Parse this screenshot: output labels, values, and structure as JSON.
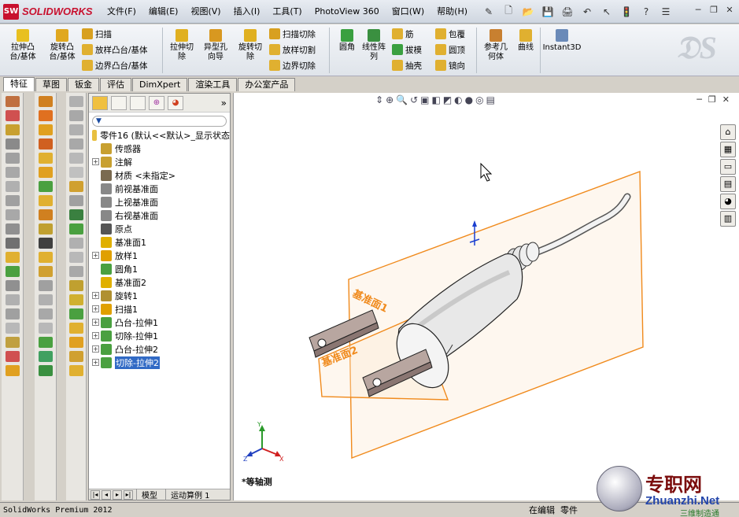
{
  "app": {
    "brand": "SOLIDWORKS"
  },
  "menu": [
    "文件(F)",
    "编辑(E)",
    "视图(V)",
    "插入(I)",
    "工具(T)",
    "PhotoView 360",
    "窗口(W)",
    "帮助(H)"
  ],
  "quick_icons": [
    "pin-icon",
    "new-icon",
    "open-icon",
    "save-icon",
    "print-icon",
    "undo-icon",
    "select-icon",
    "rebuild-icon",
    "help-icon",
    "options-icon"
  ],
  "commands": {
    "extrude_boss": "拉伸凸\n台/基体",
    "revolve_boss": "旋转凸\n台/基体",
    "sweep": "扫描",
    "loft_boss": "放样凸台/基体",
    "boundary_boss": "边界凸台/基体",
    "extrude_cut": "拉伸切\n除",
    "hole_wizard": "异型孔\n向导",
    "revolve_cut": "旋转切\n除",
    "swept_cut": "扫描切除",
    "lofted_cut": "放样切割",
    "boundary_cut": "边界切除",
    "fillet": "圆角",
    "linear_pattern": "线性阵\n列",
    "rib": "筋",
    "draft": "拔模",
    "shell": "抽壳",
    "wrap": "包覆",
    "dome": "圆顶",
    "mirror": "镜向",
    "ref_geometry": "参考几\n何体",
    "curves": "曲线",
    "instant3d": "Instant3D"
  },
  "tabs": [
    "特征",
    "草图",
    "钣金",
    "评估",
    "DimXpert",
    "渲染工具",
    "办公室产品"
  ],
  "active_tab": "特征",
  "tree": {
    "root": "零件16  (默认<<默认>_显示状态",
    "items": [
      {
        "label": "传感器",
        "expand": false,
        "color": "#c8a030"
      },
      {
        "label": "注解",
        "expand": true,
        "color": "#c8a030"
      },
      {
        "label": "材质 <未指定>",
        "expand": false,
        "color": "#7a6a50"
      },
      {
        "label": "前视基准面",
        "expand": false,
        "color": "#888888"
      },
      {
        "label": "上视基准面",
        "expand": false,
        "color": "#888888"
      },
      {
        "label": "右视基准面",
        "expand": false,
        "color": "#888888"
      },
      {
        "label": "原点",
        "expand": false,
        "color": "#555555"
      },
      {
        "label": "基准面1",
        "expand": false,
        "color": "#e0b000"
      },
      {
        "label": "放样1",
        "expand": true,
        "color": "#e0a000"
      },
      {
        "label": "圆角1",
        "expand": false,
        "color": "#4aa040"
      },
      {
        "label": "基准面2",
        "expand": false,
        "color": "#e0b000"
      },
      {
        "label": "旋转1",
        "expand": true,
        "color": "#b09030"
      },
      {
        "label": "扫描1",
        "expand": true,
        "color": "#e0a000"
      },
      {
        "label": "凸台-拉伸1",
        "expand": true,
        "color": "#4aa040"
      },
      {
        "label": "切除-拉伸1",
        "expand": true,
        "color": "#4aa040"
      },
      {
        "label": "凸台-拉伸2",
        "expand": true,
        "color": "#4aa040"
      },
      {
        "label": "切除-拉伸2",
        "expand": true,
        "color": "#4aa040",
        "selected": true
      }
    ]
  },
  "fm_bottom_tabs": [
    "模型",
    "运动算例 1"
  ],
  "viewport": {
    "view_name": "*等轴测",
    "plane_labels": [
      "基准面1",
      "基准面2"
    ],
    "plane_color": "#f08a1c"
  },
  "status": {
    "left": "SolidWorks Premium 2012",
    "mode": "在编辑",
    "doc": "零件"
  },
  "watermark": {
    "name": "专职网",
    "url": "Zhuanzhi.Net",
    "tag": "三维制造通"
  }
}
